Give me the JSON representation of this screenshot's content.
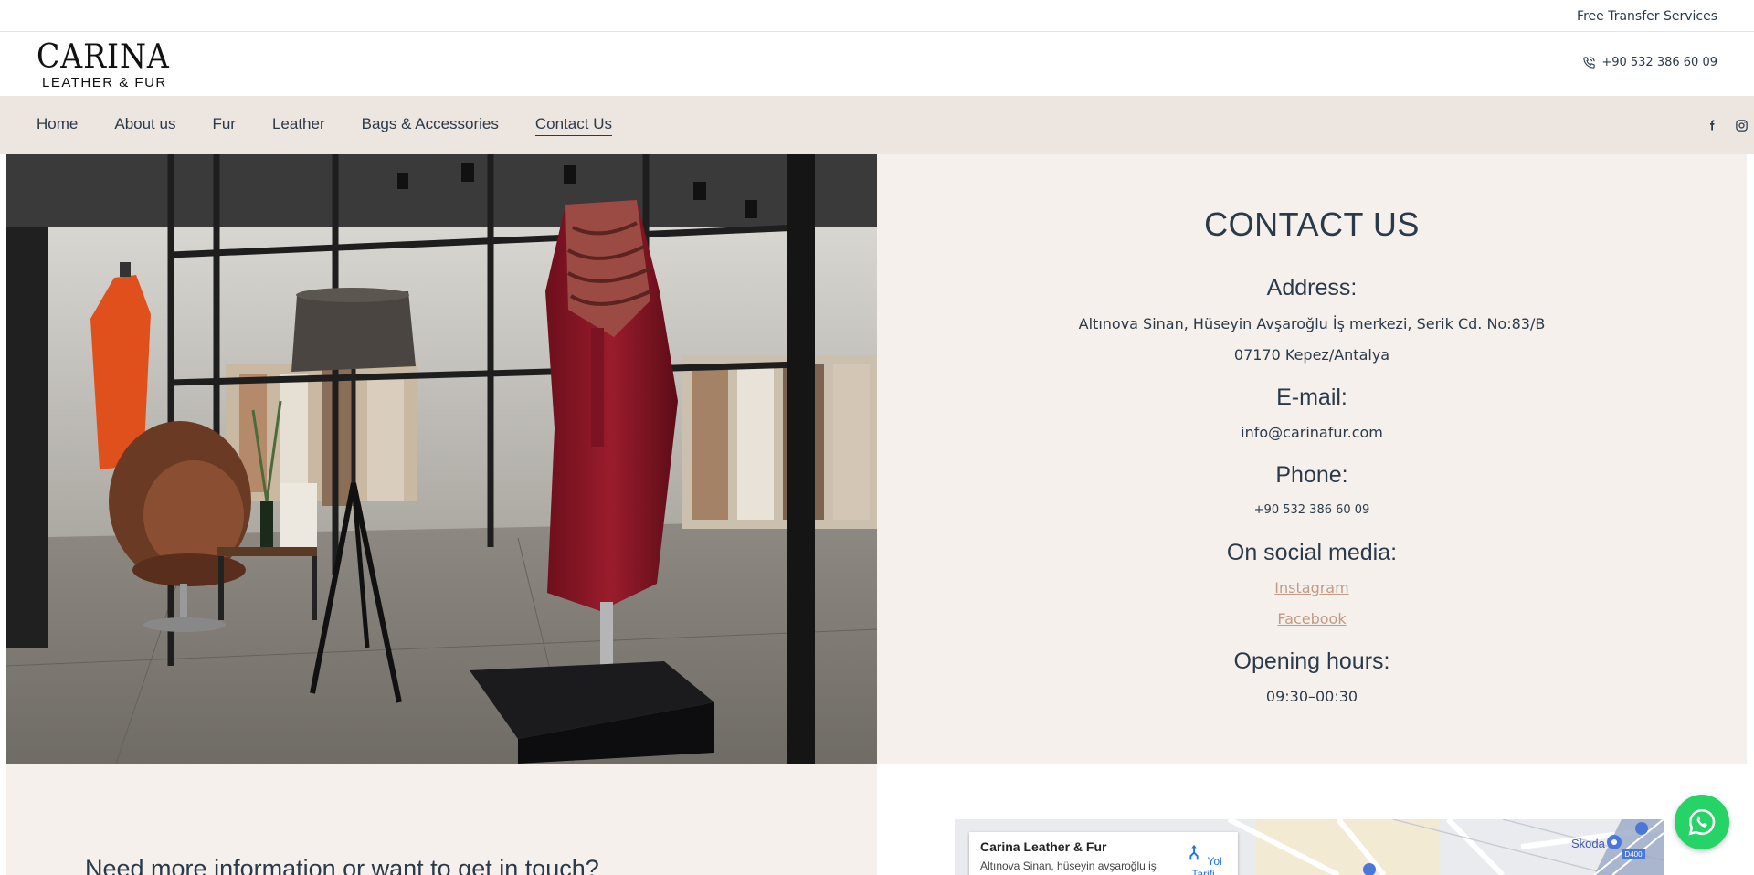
{
  "topbar": {
    "transfer_text": "Free Transfer Services"
  },
  "header": {
    "logo_brand": "CARINA",
    "logo_sub": "LEATHER & FUR",
    "phone": "+90 532 386 60 09"
  },
  "nav": {
    "items": [
      {
        "label": "Home"
      },
      {
        "label": "About us"
      },
      {
        "label": "Fur"
      },
      {
        "label": "Leather"
      },
      {
        "label": "Bags & Accessories"
      },
      {
        "label": "Contact Us"
      }
    ],
    "active": "Contact Us",
    "social": [
      "facebook-icon",
      "instagram-icon"
    ]
  },
  "contact": {
    "title": "CONTACT US",
    "address_heading": "Address:",
    "address_line1": "Altınova Sinan, Hüseyin Avşaroğlu İş merkezi, Serik Cd. No:83/B",
    "address_line2": "07170 Kepez/Antalya",
    "email_heading": "E-mail:",
    "email": "info@carinafur.com",
    "phone_heading": "Phone:",
    "phone": "+90 532 386 60 09",
    "social_heading": "On social media:",
    "instagram": "Instagram",
    "facebook": "Facebook",
    "hours_heading": "Opening hours:",
    "hours": "09:30–00:30"
  },
  "lower": {
    "question": "Need more information or want to get in touch?"
  },
  "map": {
    "place_name": "Carina Leather & Fur",
    "place_address": "Altınova Sinan, hüseyin avşaroğlu iş",
    "directions_label": "Yol Tarifi",
    "label_skoda": "Skoda",
    "label_road": "D400"
  },
  "colors": {
    "nav_bg": "#ede5df",
    "panel_bg": "#f6f0ec",
    "text": "#2a3a4a",
    "link": "#c39b84",
    "whatsapp": "#25d366"
  }
}
